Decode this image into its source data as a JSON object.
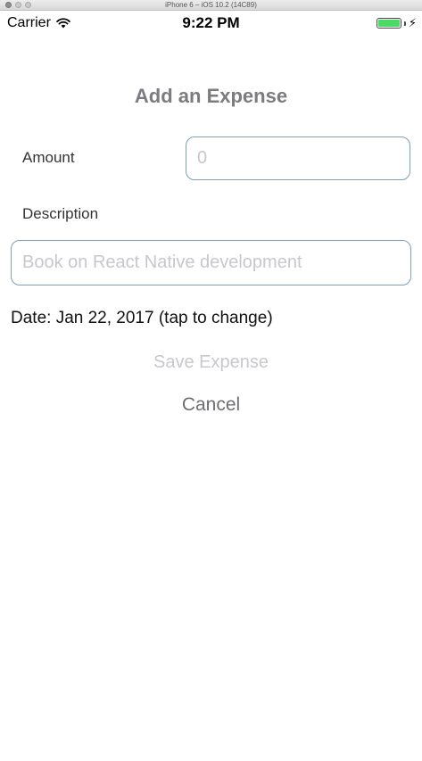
{
  "simulator": {
    "title": "iPhone 6 – iOS 10.2 (14C89)"
  },
  "status_bar": {
    "carrier": "Carrier",
    "time": "9:22 PM",
    "battery_level": 1.0,
    "battery_color": "#4cd964",
    "icons": [
      "wifi-icon",
      "battery-icon",
      "charging-bolt-icon"
    ]
  },
  "form": {
    "title": "Add an Expense",
    "amount": {
      "label": "Amount",
      "value": "",
      "placeholder": "0"
    },
    "description": {
      "label": "Description",
      "value": "",
      "placeholder": "Book on React Native development"
    },
    "date_text": "Date: Jan 22, 2017 (tap to change)",
    "save_label": "Save Expense",
    "cancel_label": "Cancel"
  },
  "colors": {
    "input_border": "#7f9fb6",
    "title": "#7b7b80",
    "disabled_button": "#c8c8cc",
    "cancel_button": "#6f6f73"
  }
}
